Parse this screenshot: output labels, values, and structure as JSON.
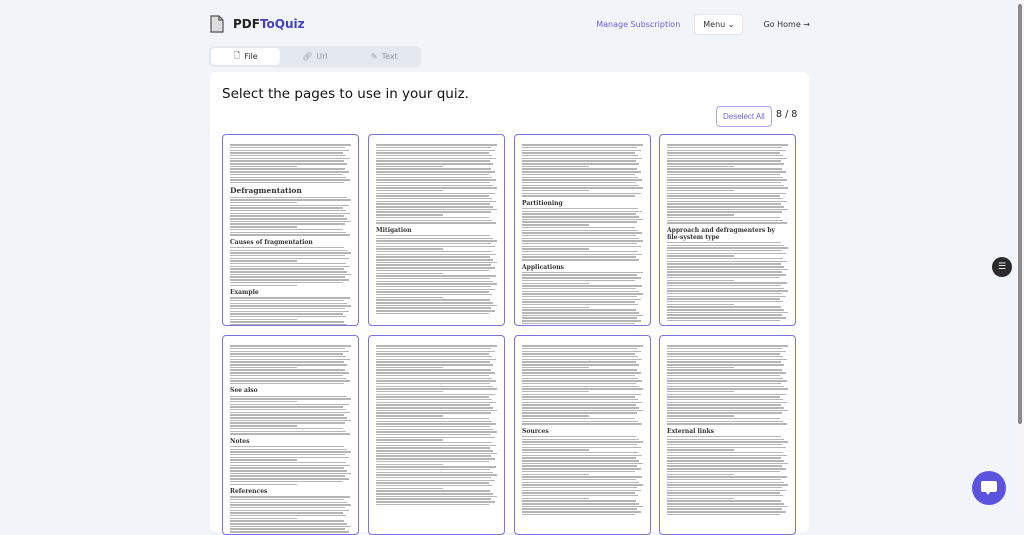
{
  "header": {
    "brand_a": "PDF",
    "brand_b": "ToQuiz",
    "manage": "Manage Subscription",
    "menu": "Menu",
    "go_home": "Go Home"
  },
  "tabs": [
    {
      "label": "File"
    },
    {
      "label": "Url"
    },
    {
      "label": "Text"
    }
  ],
  "main": {
    "title": "Select the pages to use in your quiz.",
    "deselect": "Deselect All",
    "count": "8 / 8"
  },
  "pages": [
    {
      "headings": [
        "Defragmentation",
        "Causes of fragmentation",
        "Example"
      ]
    },
    {
      "headings": [
        "Mitigation"
      ]
    },
    {
      "headings": [
        "Partitioning",
        "Applications"
      ]
    },
    {
      "headings": [
        "Approach and defragmenters by file-system type"
      ]
    },
    {
      "headings": [
        "See also",
        "Notes",
        "References"
      ]
    },
    {
      "headings": []
    },
    {
      "headings": [
        "Sources"
      ]
    },
    {
      "headings": [
        "External links"
      ]
    }
  ],
  "colors": {
    "accent": "#4a3fc1",
    "border": "#7a72dd",
    "chat": "#5b53e0"
  }
}
